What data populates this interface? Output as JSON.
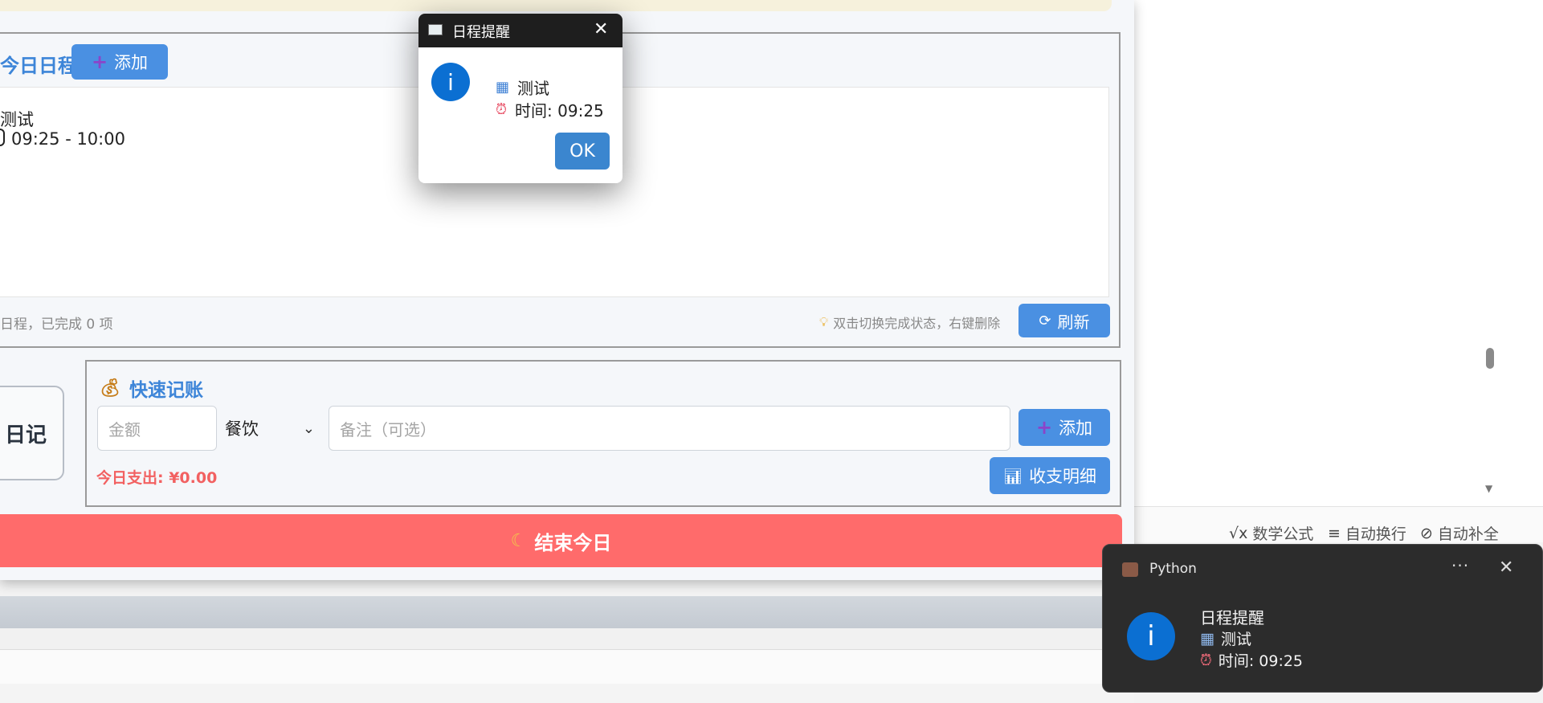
{
  "editor": {
    "statusbar": {
      "math_label": "数学公式",
      "wrap_label": "自动换行",
      "autocomplete_label": "自动补全"
    }
  },
  "app": {
    "schedule": {
      "title": "今日日程",
      "add_label": "添加",
      "item_title": "测试",
      "item_time": "09:25 - 10:00",
      "summary": "日程，已完成 0 项",
      "hint": "双击切换完成状态，右键删除",
      "refresh_label": "刷新"
    },
    "diary": {
      "label": "日记"
    },
    "ledger": {
      "title": "快速记账",
      "amount_placeholder": "金额",
      "category_selected": "餐饮",
      "note_placeholder": "备注（可选）",
      "add_label": "添加",
      "today_expense": "今日支出: ¥0.00",
      "details_label": "收支明细"
    },
    "end_day_label": "结束今日"
  },
  "dialog": {
    "title": "日程提醒",
    "line1": "测试",
    "line2": "时间: 09:25",
    "ok_label": "OK"
  },
  "toast": {
    "app_name": "Python",
    "title": "日程提醒",
    "line1": "测试",
    "line2": "时间: 09:25"
  },
  "colors": {
    "accent": "#4a90e2",
    "end_day": "#ff6b6b",
    "expense": "#f26161",
    "dialog_titlebar": "#1e1e1e",
    "toast_bg": "#2c2c2c"
  },
  "icons": [
    "plus-icon",
    "refresh-icon",
    "lightbulb-icon",
    "money-bag-icon",
    "chevron-down-icon",
    "bar-chart-icon",
    "moon-icon",
    "info-icon",
    "calendar-icon",
    "alarm-clock-icon",
    "close-icon",
    "more-icon"
  ]
}
